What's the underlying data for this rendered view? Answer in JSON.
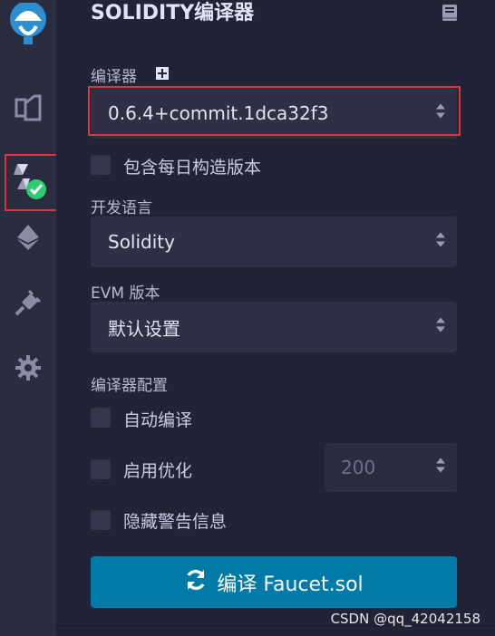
{
  "sidebar": {
    "items": [
      {
        "name": "logo"
      },
      {
        "name": "file-explorer"
      },
      {
        "name": "solidity-compiler",
        "active": true
      },
      {
        "name": "deploy-run"
      },
      {
        "name": "plugin-manager"
      },
      {
        "name": "settings"
      }
    ]
  },
  "panel": {
    "title": "SOLIDITY编译器",
    "compiler_label": "编译器",
    "compiler_version": "0.6.4+commit.1dca32f3",
    "include_nightly_label": "包含每日构造版本",
    "language_label": "开发语言",
    "language_value": "Solidity",
    "evm_label": "EVM 版本",
    "evm_value": "默认设置",
    "config_label": "编译器配置",
    "auto_compile_label": "自动编译",
    "optimize_label": "启用优化",
    "optimize_runs": "200",
    "hide_warnings_label": "隐藏警告信息",
    "compile_button": "编译 Faucet.sol"
  },
  "watermark": "CSDN @qq_42042158",
  "colors": {
    "accent": "#007aa6",
    "highlight": "#e0343d",
    "success": "#2ecc71"
  }
}
